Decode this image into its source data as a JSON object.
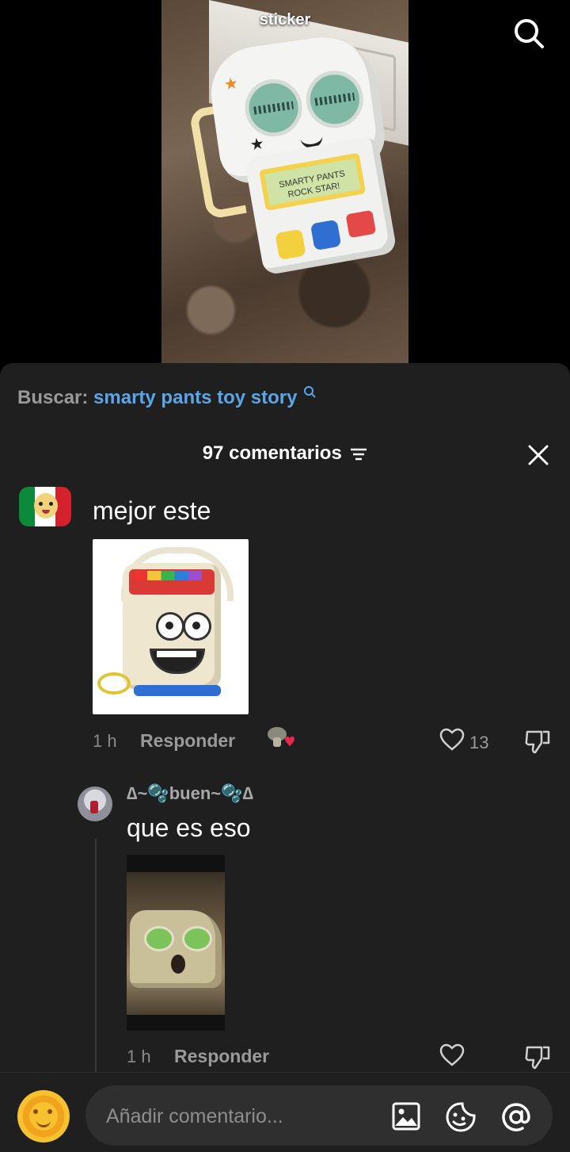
{
  "video": {
    "caption": "sticker",
    "screen_text": "SMARTY PANTS ROCK STAR!"
  },
  "sheet": {
    "search_prefix": "Buscar:",
    "search_query": "smarty pants toy story",
    "comment_count": "97 comentarios"
  },
  "comments": [
    {
      "text": "mejor este",
      "time": "1 h",
      "reply_label": "Responder",
      "likes": "13"
    },
    {
      "username": "∆~🫧buen~🫧∆",
      "text": "que es eso",
      "time": "1 h",
      "reply_label": "Responder"
    }
  ],
  "composer": {
    "placeholder": "Añadir comentario..."
  },
  "colors": {
    "sheet_bg": "#1f1f1f",
    "link_blue": "#5aa6e8",
    "muted_text": "#8a8a8a"
  },
  "icons": [
    "search-icon",
    "close-icon",
    "filter-icon",
    "heart-icon",
    "dislike-icon",
    "image-icon",
    "sticker-icon",
    "mention-icon"
  ]
}
